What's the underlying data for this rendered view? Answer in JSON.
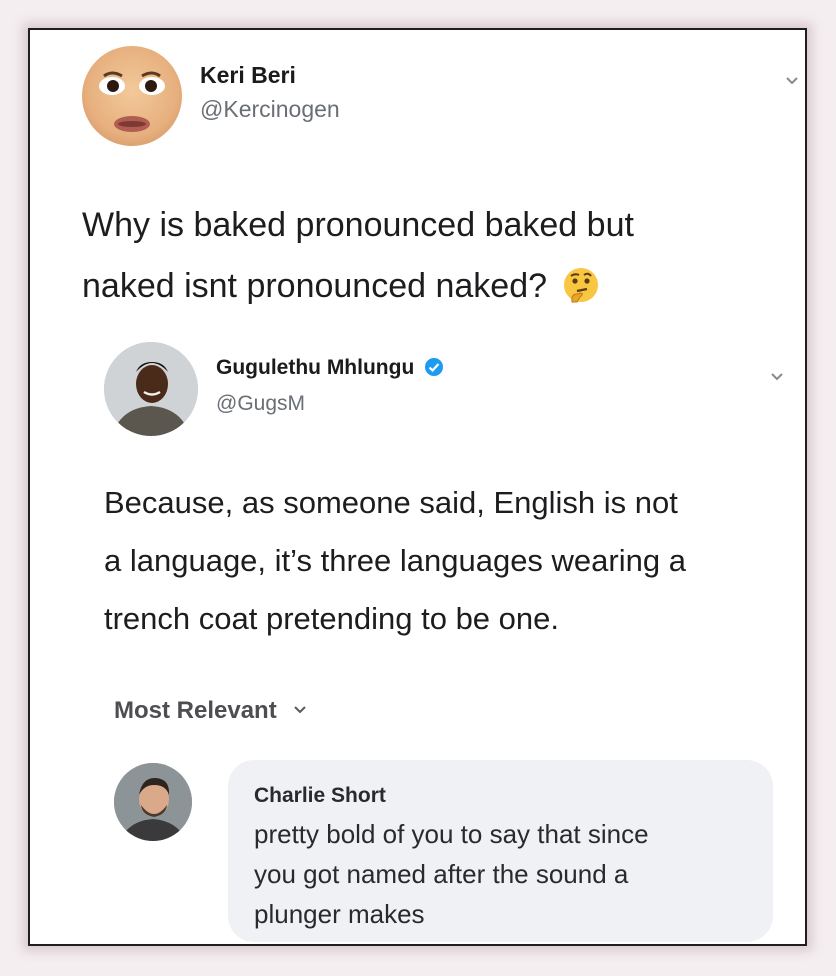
{
  "tweet1": {
    "name": "Keri Beri",
    "handle": "@Kercinogen",
    "text_lines": [
      "Why is baked pronounced baked but",
      "naked isnt pronounced naked?"
    ],
    "emoji": "thinking-face"
  },
  "tweet2": {
    "name": "Gugulethu Mhlungu",
    "handle": "@GugsM",
    "verified": true,
    "text_lines": [
      "Because, as someone said, English is not",
      "a language, it’s three languages wearing a",
      "trench coat pretending to be one."
    ]
  },
  "comments": {
    "sort_label": "Most Relevant",
    "items": [
      {
        "name": "Charlie Short",
        "text_lines": [
          "pretty bold of you to say that since",
          "you got named after the sound a",
          "plunger makes"
        ]
      }
    ]
  },
  "colors": {
    "verified": "#1d9bf0",
    "bubble": "#f0f1f4",
    "handle": "#6a6f75"
  }
}
